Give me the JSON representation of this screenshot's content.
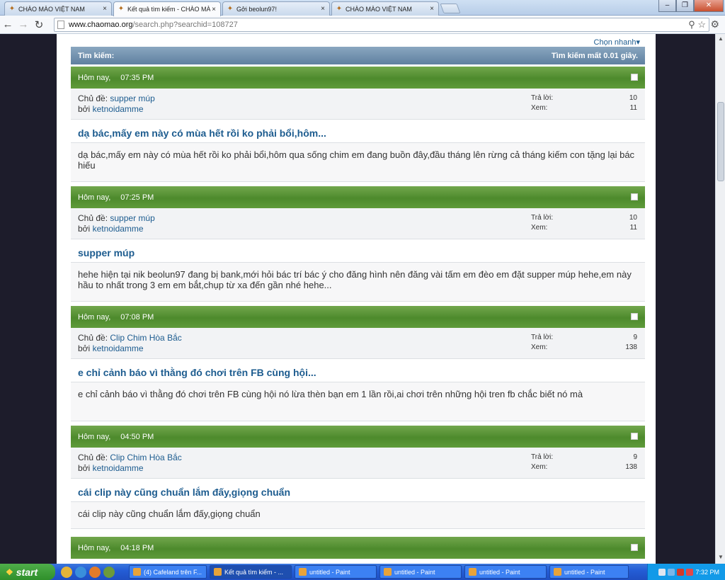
{
  "browser": {
    "tabs": [
      {
        "label": "CHÀO MÀO VIỆT NAM"
      },
      {
        "label": "Kết quả tìm kiếm - CHÀO MÀO"
      },
      {
        "label": "Gởi beolun97!"
      },
      {
        "label": "CHÀO MÀO VIỆT NAM"
      }
    ],
    "url_host": "www.chaomao.org",
    "url_path": "/search.php?searchid=108727"
  },
  "page": {
    "quick_nav": "Chọn nhanh",
    "search_label": "Tìm kiếm:",
    "search_time": "Tìm kiếm mất 0.01 giây."
  },
  "labels": {
    "topic": "Chủ đề:",
    "by": "bởi",
    "replies": "Trả lời:",
    "views": "Xem:"
  },
  "results": [
    {
      "date": "Hôm nay,",
      "time": "07:35 PM",
      "topic": "supper múp",
      "author": "ketnoidamme",
      "replies": "10",
      "views": "11",
      "title": "dạ bác,mấy em này có mùa hết rồi ko phải bổi,hôm...",
      "body": "dạ bác,mấy em này có mùa hết rồi ko phải bổi,hôm qua sống chim em đang buồn đây,đầu tháng lên rừng cả tháng kiếm con tặng lại bác hiếu"
    },
    {
      "date": "Hôm nay,",
      "time": "07:25 PM",
      "topic": "supper múp",
      "author": "ketnoidamme",
      "replies": "10",
      "views": "11",
      "title": "supper múp",
      "body": "hehe hiện tại nik beolun97 đang bị bank,mới hỏi bác trí bác ý cho đăng hình nên đăng vài tấm em đèo em đặt supper múp hehe,em này hầu to nhất trong 3 em em bắt,chụp từ xa đến gần nhé hehe..."
    },
    {
      "date": "Hôm nay,",
      "time": "07:08 PM",
      "topic": "Clip Chim Hòa Bắc",
      "author": "ketnoidamme",
      "replies": "9",
      "views": "138",
      "title": "e chỉ cảnh báo vì thằng đó chơi trên FB cùng hội...",
      "body": "e chỉ cảnh báo vì thằng đó chơi trên FB cùng hội nó lừa thèn bạn em 1 lần rồi,ai chơi trên những hội tren fb chắc biết nó mà"
    },
    {
      "date": "Hôm nay,",
      "time": "04:50 PM",
      "topic": "Clip Chim Hòa Bắc",
      "author": "ketnoidamme",
      "replies": "9",
      "views": "138",
      "title": "cái clip này cũng chuẩn lắm đấy,giọng chuẩn",
      "body": "cái clip này cũng chuẩn lắm đấy,giọng chuẩn"
    },
    {
      "date": "Hôm nay,",
      "time": "04:18 PM"
    }
  ],
  "taskbar": {
    "start": "start",
    "tasks": [
      {
        "label": "(4) Cafeland trên F..."
      },
      {
        "label": "Kết quả tìm kiếm - ..."
      },
      {
        "label": "untitled - Paint"
      },
      {
        "label": "untitled - Paint"
      },
      {
        "label": "untitled - Paint"
      },
      {
        "label": "untitled - Paint"
      }
    ],
    "clock": "7:32 PM"
  }
}
